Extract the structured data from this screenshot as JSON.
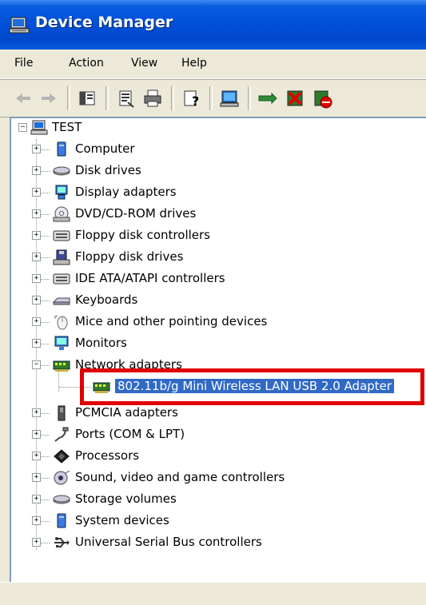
{
  "window": {
    "title": "Device Manager",
    "title_color": "#0054e3",
    "selection_color": "#316ac5",
    "highlight_color": "#e00000"
  },
  "menu": {
    "items": [
      "File",
      "Action",
      "View",
      "Help"
    ]
  },
  "toolbar": {
    "buttons": [
      {
        "icon": "back-arrow-icon"
      },
      {
        "icon": "forward-arrow-icon"
      },
      {
        "icon": "show-hide-console-tree-icon"
      },
      {
        "icon": "properties-icon"
      },
      {
        "icon": "print-icon"
      },
      {
        "icon": "help-icon"
      },
      {
        "icon": "scan-hardware-icon"
      },
      {
        "icon": "update-driver-icon"
      },
      {
        "icon": "uninstall-icon"
      },
      {
        "icon": "disable-icon"
      }
    ]
  },
  "tree": {
    "root": {
      "label": "TEST",
      "expander": "−"
    },
    "items": [
      {
        "label": "Computer",
        "icon": "computer-icon",
        "expander": "+"
      },
      {
        "label": "Disk drives",
        "icon": "disk-drive-icon",
        "expander": "+"
      },
      {
        "label": "Display adapters",
        "icon": "display-adapter-icon",
        "expander": "+"
      },
      {
        "label": "DVD/CD-ROM drives",
        "icon": "cdrom-icon",
        "expander": "+"
      },
      {
        "label": "Floppy disk controllers",
        "icon": "floppy-controller-icon",
        "expander": "+"
      },
      {
        "label": "Floppy disk drives",
        "icon": "floppy-drive-icon",
        "expander": "+"
      },
      {
        "label": "IDE ATA/ATAPI controllers",
        "icon": "ide-controller-icon",
        "expander": "+"
      },
      {
        "label": "Keyboards",
        "icon": "keyboard-icon",
        "expander": "+"
      },
      {
        "label": "Mice and other pointing devices",
        "icon": "mouse-icon",
        "expander": "+"
      },
      {
        "label": "Monitors",
        "icon": "monitor-icon",
        "expander": "+"
      },
      {
        "label": "Network adapters",
        "icon": "network-adapter-icon",
        "expander": "−"
      },
      {
        "label": "PCMCIA adapters",
        "icon": "pcmcia-icon",
        "expander": "+"
      },
      {
        "label": "Ports (COM & LPT)",
        "icon": "port-icon",
        "expander": "+"
      },
      {
        "label": "Processors",
        "icon": "processor-icon",
        "expander": "+"
      },
      {
        "label": "Sound, video and game controllers",
        "icon": "sound-icon",
        "expander": "+"
      },
      {
        "label": "Storage volumes",
        "icon": "storage-volume-icon",
        "expander": "+"
      },
      {
        "label": "System devices",
        "icon": "system-device-icon",
        "expander": "+"
      },
      {
        "label": "Universal Serial Bus controllers",
        "icon": "usb-icon",
        "expander": "+"
      }
    ],
    "child": {
      "label": "802.11b/g Mini Wireless LAN USB 2.0 Adapter",
      "icon": "network-adapter-icon"
    }
  }
}
